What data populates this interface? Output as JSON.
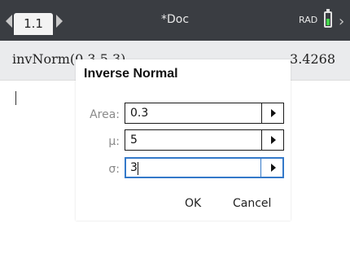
{
  "titlebar": {
    "tab_label": "1.1",
    "doc_title": "*Doc",
    "angle_mode": "RAD",
    "battery_level": 0.6,
    "colors": {
      "bar": "#3a3d42",
      "battery": "#43d64b"
    }
  },
  "history": {
    "expression": "invNorm(0.3,5,3)",
    "result": "3.4268"
  },
  "dialog": {
    "title": "Inverse Normal",
    "fields": [
      {
        "label": "Area:",
        "value": "0.3"
      },
      {
        "label": "μ:",
        "value": "5"
      },
      {
        "label": "σ:",
        "value": "3"
      }
    ],
    "ok_label": "OK",
    "cancel_label": "Cancel",
    "focus_color": "#3479c9"
  }
}
